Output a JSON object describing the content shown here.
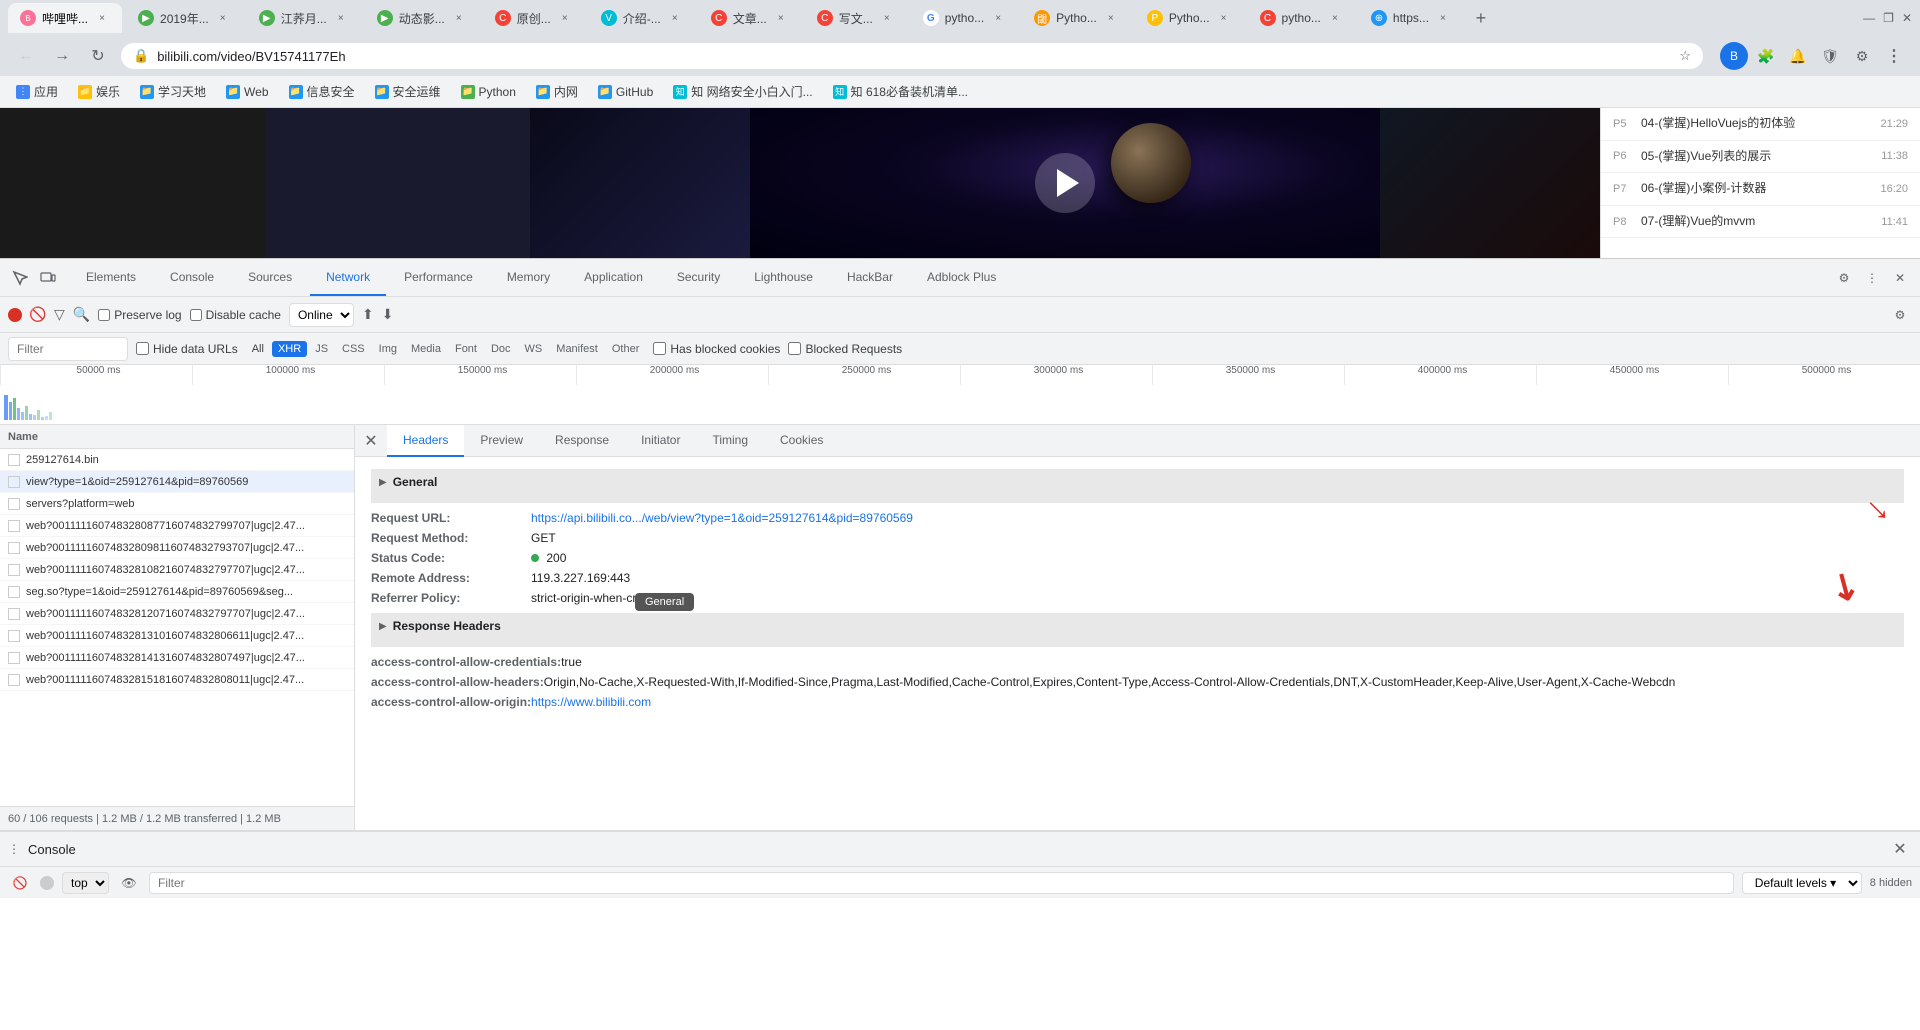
{
  "browser": {
    "url": "bilibili.com/video/BV15741177Eh",
    "tabs": [
      {
        "id": "t1",
        "icon": "bili",
        "label": "哔哩哔...",
        "active": true
      },
      {
        "id": "t2",
        "icon": "green",
        "label": "2019年...",
        "active": false
      },
      {
        "id": "t3",
        "icon": "green",
        "label": "江荞月...",
        "active": false
      },
      {
        "id": "t4",
        "icon": "green",
        "label": "动态影...",
        "active": false
      },
      {
        "id": "t5",
        "icon": "red",
        "label": "原创...",
        "active": false
      },
      {
        "id": "t6",
        "icon": "teal",
        "label": "介绍-...",
        "active": false
      },
      {
        "id": "t7",
        "icon": "red",
        "label": "文章...",
        "active": false
      },
      {
        "id": "t8",
        "icon": "red",
        "label": "写文...",
        "active": false
      },
      {
        "id": "t9",
        "icon": "google",
        "label": "pytho...",
        "active": false
      },
      {
        "id": "t10",
        "icon": "orange",
        "label": "Pytho...",
        "active": false
      },
      {
        "id": "t11",
        "icon": "yellow",
        "label": "Pytho...",
        "active": false
      },
      {
        "id": "t12",
        "icon": "red",
        "label": "pytho...",
        "active": false
      },
      {
        "id": "t13",
        "icon": "blue",
        "label": "https...",
        "active": false
      }
    ],
    "bookmarks": [
      {
        "icon": "apps",
        "label": "应用"
      },
      {
        "icon": "yellow2",
        "label": "娱乐"
      },
      {
        "icon": "blue2",
        "label": "学习天地"
      },
      {
        "icon": "blue2",
        "label": "Web"
      },
      {
        "icon": "blue2",
        "label": "信息安全"
      },
      {
        "icon": "blue2",
        "label": "安全运维"
      },
      {
        "icon": "green2",
        "label": "Python"
      },
      {
        "icon": "blue2",
        "label": "内网"
      },
      {
        "icon": "blue2",
        "label": "GitHub"
      },
      {
        "icon": "cyan",
        "label": "知 网络安全小白入门..."
      },
      {
        "icon": "cyan",
        "label": "知 618必备装机清单..."
      }
    ]
  },
  "playlist": {
    "items": [
      {
        "num": "P5",
        "title": "04-(掌握)HelloVuejs的初体验",
        "duration": "21:29"
      },
      {
        "num": "P6",
        "title": "05-(掌握)Vue列表的展示",
        "duration": "11:38"
      },
      {
        "num": "P7",
        "title": "06-(掌握)小案例-计数器",
        "duration": "16:20"
      },
      {
        "num": "P8",
        "title": "07-(理解)Vue的mvvm",
        "duration": "11:41"
      }
    ]
  },
  "devtools": {
    "tabs": [
      {
        "id": "elements",
        "label": "Elements",
        "active": false
      },
      {
        "id": "console",
        "label": "Console",
        "active": false
      },
      {
        "id": "sources",
        "label": "Sources",
        "active": false
      },
      {
        "id": "network",
        "label": "Network",
        "active": true
      },
      {
        "id": "performance",
        "label": "Performance",
        "active": false
      },
      {
        "id": "memory",
        "label": "Memory",
        "active": false
      },
      {
        "id": "application",
        "label": "Application",
        "active": false
      },
      {
        "id": "security",
        "label": "Security",
        "active": false
      },
      {
        "id": "lighthouse",
        "label": "Lighthouse",
        "active": false
      },
      {
        "id": "hackbar",
        "label": "HackBar",
        "active": false
      },
      {
        "id": "adblock",
        "label": "Adblock Plus",
        "active": false
      }
    ],
    "network": {
      "preserve_log": false,
      "disable_cache": false,
      "online_label": "Online",
      "filter_placeholder": "Filter",
      "hide_data_urls": false,
      "filter_types": [
        "All",
        "XHR",
        "JS",
        "CSS",
        "Img",
        "Media",
        "Font",
        "Doc",
        "WS",
        "Manifest",
        "Other"
      ],
      "active_filter": "XHR",
      "has_blocked_cookies": false,
      "blocked_requests": false,
      "timeline_labels": [
        "50000 ms",
        "100000 ms",
        "150000 ms",
        "200000 ms",
        "250000 ms",
        "300000 ms",
        "350000 ms",
        "400000 ms",
        "450000 ms",
        "500000 ms"
      ]
    },
    "files": [
      {
        "name": "259127614.bin",
        "selected": false
      },
      {
        "name": "view?type=1&oid=259127614&pid=89760569",
        "selected": true
      },
      {
        "name": "servers?platform=web",
        "selected": false
      },
      {
        "name": "web?001111160748328087716074832799707|ugc|2.47...",
        "selected": false
      },
      {
        "name": "web?001111160748328098116074832793707|ugc|2.47...",
        "selected": false
      },
      {
        "name": "web?001111160748328108216074832797707|ugc|2.47...",
        "selected": false
      },
      {
        "name": "seg.so?type=1&oid=259127614&pid=89760569&seg...",
        "selected": false
      },
      {
        "name": "web?001111160748328120716074832797707|ugc|2.47...",
        "selected": false
      },
      {
        "name": "web?001111160748328131016074832806611|ugc|2.47...",
        "selected": false
      },
      {
        "name": "web?001111160748328141316074832807497|ugc|2.47...",
        "selected": false
      },
      {
        "name": "web?001111160748328151816074832808011|ugc|2.47...",
        "selected": false
      }
    ],
    "footer": "60 / 106 requests  |  1.2 MB / 1.2 MB transferred  |  1.2 MB",
    "detail": {
      "tabs": [
        "Headers",
        "Preview",
        "Response",
        "Initiator",
        "Timing",
        "Cookies"
      ],
      "active_tab": "Headers",
      "general": {
        "section_title": "General",
        "request_url_label": "Request URL:",
        "request_url_value": "https://api.bilibili.co.../web/view?type=1&oid=259127614&pid=89760569",
        "request_method_label": "Request Method:",
        "request_method_value": "GET",
        "status_code_label": "Status Code:",
        "status_code_value": "200",
        "remote_address_label": "Remote Address:",
        "remote_address_value": "119.3.227.169:443",
        "referrer_policy_label": "Referrer Policy:",
        "referrer_policy_value": "strict-origin-when-cross-origin"
      },
      "response_headers": {
        "section_title": "Response Headers",
        "headers": [
          {
            "key": "access-control-allow-credentials:",
            "value": "true"
          },
          {
            "key": "access-control-allow-headers:",
            "value": "Origin,No-Cache,X-Requested-With,If-Modified-Since,Pragma,Last-Modified,Cache-Control,Expires,Content-Type,Access-Control-Allow-Credentials,DNT,X-CustomHeader,Keep-Alive,User-Agent,X-Cache-Webcdn"
          },
          {
            "key": "access-control-allow-origin:",
            "value": "https://www.bilibili.com"
          }
        ]
      },
      "tooltip": "General"
    }
  },
  "console_bar": {
    "tab_label": "Console",
    "close_label": "×",
    "top_label": "top",
    "filter_placeholder": "Filter",
    "levels_label": "Default levels ▾",
    "hidden_count": "8 hidden"
  }
}
